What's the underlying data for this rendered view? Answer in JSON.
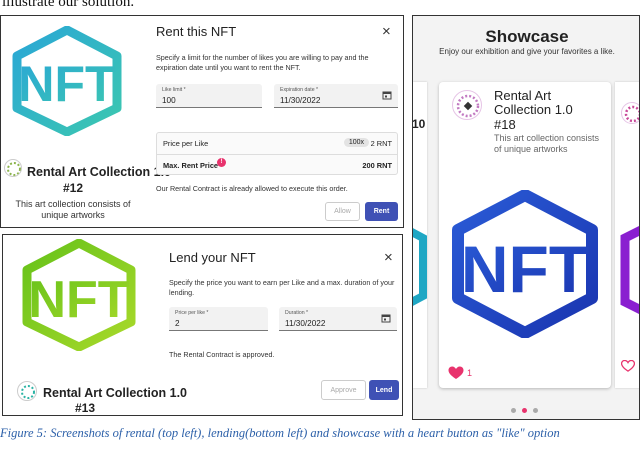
{
  "intro_text": "illustrate our solution.",
  "rent_card": {
    "logo_text": "NFT",
    "title": "Rental Art Collection 1.0",
    "number": "#12",
    "description": "This art collection consists of unique artworks"
  },
  "rent_dialog": {
    "title": "Rent this NFT",
    "close": "×",
    "description": "Specify a limit for the number of likes you are willing to pay and the expiration date until you want to rent the NFT.",
    "like_limit_label": "Like limit *",
    "like_limit_value": "100",
    "expiration_label": "Expiration date *",
    "expiration_value": "11/30/2022",
    "price_per_like_label": "Price per Like",
    "multiplier": "100x",
    "price_per_like_value": "2 RNT",
    "max_rent_label": "Max. Rent Price",
    "max_rent_value": "200 RNT",
    "contract_note": "Our Rental Contract is already allowed to execute this order.",
    "allow_button": "Allow",
    "rent_button": "Rent"
  },
  "lend_card": {
    "logo_text": "NFT",
    "title": "Rental Art Collection 1.0",
    "number": "#13"
  },
  "lend_dialog": {
    "title": "Lend your NFT",
    "close": "×",
    "description": "Specify the price you want to earn per Like and a max. duration of your lending.",
    "price_label": "Price per like *",
    "price_value": "2",
    "duration_label": "Duration *",
    "duration_value": "11/30/2022",
    "contract_note": "The Rental Contract is approved.",
    "approve_button": "Approve",
    "lend_button": "Lend"
  },
  "showcase": {
    "title": "Showcase",
    "subtitle": "Enjoy our exhibition and give your favorites a like.",
    "left_partial": "10",
    "card_title": "Rental Art Collection 1.0",
    "card_number": "#18",
    "card_description": "This art collection consists of unique artworks",
    "logo_text": "NFT",
    "like_count": "1",
    "carousel_dots": 3,
    "active_dot": 1
  },
  "caption": "Figure 5: Screenshots of rental (top left), lending(bottom left) and showcase with a heart button as \"like\" option",
  "colors": {
    "rent_logo": "#2fb5c9",
    "lend_logo": "#7bc81e",
    "showcase_logo": "#1f3fc2",
    "primary_button": "#3f51b5",
    "heart": "#e8336d",
    "caption": "#2b5fa8"
  }
}
